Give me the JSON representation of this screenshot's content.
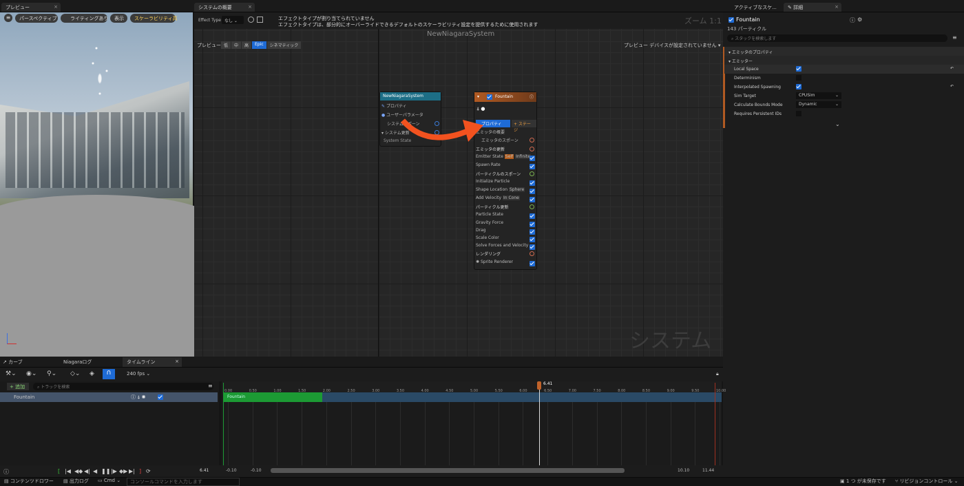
{
  "preview": {
    "tab": "プレビュー",
    "btn_perspective": "パースペクティブ",
    "btn_lighting": "ライティングあり",
    "btn_show": "表示",
    "btn_scalability": "スケーラビリティ高"
  },
  "system_overview": {
    "tab": "システムの概要",
    "effect_type_label": "Effect Type",
    "effect_type_value": "なし",
    "warning_1": "エフェクトタイプが割り当てられていません",
    "warning_2": "エフェクトタイプは、部分的にオーバーライドできるデフォルトのスケーラビリティ設定を提供するために使用されます",
    "zoom": "ズーム 1:1",
    "system_name": "NewNiagaraSystem",
    "preview_label": "プレビュー",
    "quality": [
      "低",
      "中",
      "高",
      "Epic",
      "シネマティック"
    ],
    "preview_device": "プレビュー デバイスが設定されていません",
    "watermark": "システム",
    "system_node": {
      "title": "NewNiagaraSystem",
      "rows": [
        "プロパティ",
        "ユーザーパラメータ",
        "システムスポーン",
        "システム更新",
        "System State"
      ]
    },
    "emitter_node": {
      "title": "Fountain",
      "tab_props": "プロパティ",
      "tab_stage": "+ ステージ",
      "summary": "エミッタの概要",
      "spawn": "エミッタのスポーン",
      "update": "エミッタの更新",
      "emitter_state": "Emitter State",
      "self": "Self",
      "infinite": "Infinite",
      "spawn_rate": "Spawn Rate",
      "particle_spawn": "パーティクルのスポーン",
      "init_particle": "Initialize Particle",
      "shape_location": "Shape Location",
      "sphere": "Sphere",
      "add_velocity": "Add Velocity",
      "in_cone": "In Cone",
      "particle_update": "パーティクル更新",
      "particle_state": "Particle State",
      "gravity": "Gravity Force",
      "drag": "Drag",
      "scale_color": "Scale Color",
      "solve": "Solve Forces and Velocity",
      "rendering": "レンダリング",
      "sprite": "Sprite Renderer"
    }
  },
  "details": {
    "tab_active": "アクティブなスケ...",
    "tab_details": "詳細",
    "name": "Fountain",
    "particles": "143 パーティクル",
    "search_placeholder": "スタックを検索します",
    "section_emitter_props": "エミッタのプロパティ",
    "section_emitter": "エミッター",
    "local_space": "Local Space",
    "determinism": "Determinism",
    "interpolated": "Interpolated Spawning",
    "sim_target": "Sim Target",
    "sim_target_value": "CPUSim",
    "calc_bounds": "Calculate Bounds Mode",
    "calc_bounds_value": "Dynamic",
    "persistent_ids": "Requires Persistent IDs"
  },
  "timeline": {
    "tab_curve": "カーブ",
    "tab_log": "Niagaraログ",
    "tab_timeline": "タイムライン",
    "fps": "240 fps",
    "add_btn": "+ 追加",
    "search_placeholder": "トラックを検索",
    "track": "Fountain",
    "clip": "Fountain",
    "current": "6.41",
    "start": "-0.10",
    "start2": "-0.10",
    "end1": "10.10",
    "end2": "11.44",
    "ticks": [
      "0.00",
      "0.50",
      "1.00",
      "1.50",
      "2.00",
      "2.50",
      "3.00",
      "3.50",
      "4.00",
      "4.50",
      "5.00",
      "5.50",
      "6.00",
      "6.50",
      "7.00",
      "7.50",
      "8.00",
      "8.50",
      "9.00",
      "9.50",
      "10.00"
    ]
  },
  "statusbar": {
    "content_drawer": "コンテンツドロワー",
    "output_log": "出力ログ",
    "cmd": "Cmd",
    "console_placeholder": "コンソールコマンドを入力します",
    "unsaved": "1 つ が未保存です",
    "revision": "リビジョンコントロール"
  }
}
